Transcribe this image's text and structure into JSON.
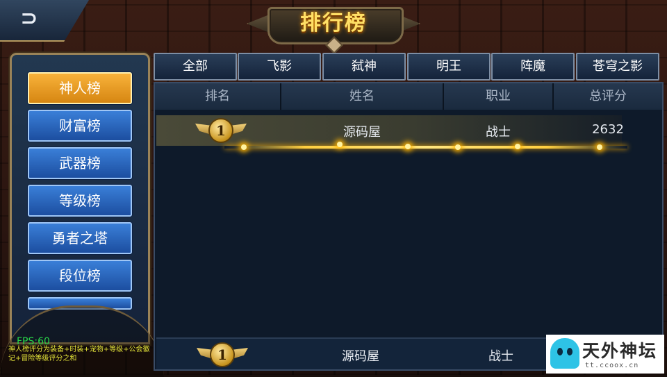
{
  "header": {
    "title": "排行榜",
    "back_glyph": "⊃"
  },
  "sidebar": {
    "items": [
      {
        "label": "神人榜",
        "active": true
      },
      {
        "label": "财富榜"
      },
      {
        "label": "武器榜"
      },
      {
        "label": "等级榜"
      },
      {
        "label": "勇者之塔"
      },
      {
        "label": "段位榜"
      }
    ]
  },
  "tabs": [
    "全部",
    "飞影",
    "弑神",
    "明王",
    "阵魔",
    "苍穹之影"
  ],
  "table": {
    "columns": [
      "排名",
      "姓名",
      "职业",
      "总评分"
    ],
    "rows": [
      {
        "rank": "1",
        "name": "源码屋",
        "class": "战士",
        "score": "2632"
      }
    ],
    "my_row": {
      "rank": "1",
      "name": "源码屋",
      "class": "战士"
    }
  },
  "debug": {
    "fps": "FPS:60"
  },
  "note": "神人榜评分为装备+时装+宠物+等级+公会徽记+冒险等级评分之和",
  "watermark": {
    "title": "天外神坛",
    "url": "tt.ccoox.cn"
  }
}
